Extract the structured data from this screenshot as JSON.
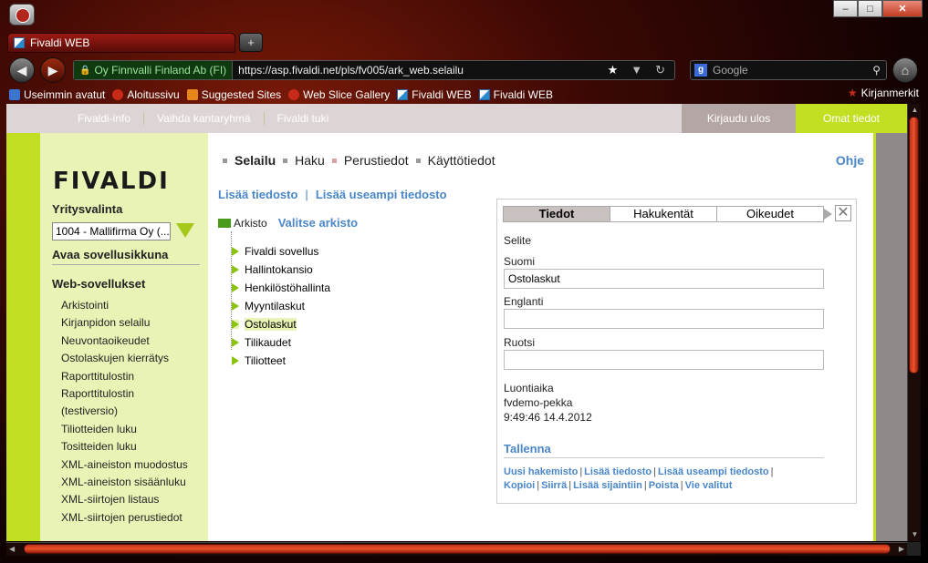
{
  "browser": {
    "tab_title": "Fivaldi WEB",
    "site_identity": "Oy Finnvalli Finland Ab (FI)",
    "url": "https://asp.fivaldi.net/pls/fv005/ark_web.selailu",
    "search_placeholder": "Google",
    "bookmarks": [
      "Useimmin avatut",
      "Aloitussivu",
      "Suggested Sites",
      "Web Slice Gallery",
      "Fivaldi WEB",
      "Fivaldi WEB"
    ],
    "bookmarks_menu": "Kirjanmerkit"
  },
  "topnav": {
    "links": [
      "Fivaldi-info",
      "Vaihda kantaryhmä",
      "Fivaldi tuki"
    ],
    "logout": "Kirjaudu ulos",
    "my_info": "Omat tiedot"
  },
  "sidebar": {
    "logo": "FIVALDI",
    "company_label": "Yritysvalinta",
    "company_value": "1004 - Mallifirma Oy (...",
    "open_window": "Avaa sovellusikkuna",
    "web_apps_label": "Web-sovellukset",
    "items": [
      "Arkistointi",
      "Kirjanpidon selailu",
      "Neuvontaoikeudet",
      "Ostolaskujen kierrätys",
      "Raporttitulostin",
      "Raporttitulostin",
      "(testiversio)",
      "Tiliotteiden luku",
      "Tositteiden luku",
      "XML-aineiston muodostus",
      "XML-aineiston sisäänluku",
      "XML-siirtojen listaus",
      "XML-siirtojen perustiedot"
    ]
  },
  "main": {
    "subnav": [
      "Selailu",
      "Haku",
      "Perustiedot",
      "Käyttötiedot"
    ],
    "help": "Ohje",
    "add_file": "Lisää tiedosto",
    "add_many": "Lisää useampi tiedosto",
    "separator": "|",
    "tree_root": "Arkisto",
    "choose_archive": "Valitse arkisto",
    "tree_items": [
      "Fivaldi sovellus",
      "Hallintokansio",
      "Henkilöstöhallinta",
      "Myyntilaskut",
      "Ostolaskut",
      "Tilikaudet",
      "Tiliotteet"
    ],
    "selected_item": "Ostolaskut"
  },
  "detail": {
    "tabs": [
      "Tiedot",
      "Hakukentät",
      "Oikeudet"
    ],
    "active_tab": "Tiedot",
    "selite_label": "Selite",
    "suomi_label": "Suomi",
    "suomi_value": "Ostolaskut",
    "englanti_label": "Englanti",
    "englanti_value": "",
    "ruotsi_label": "Ruotsi",
    "ruotsi_value": "",
    "created_label": "Luontiaika",
    "created_by": "fvdemo-pekka",
    "created_at": "9:49:46 14.4.2012",
    "save": "Tallenna",
    "actions_row1": [
      "Uusi hakemisto",
      "Lisää tiedosto",
      "Lisää useampi tiedosto"
    ],
    "actions_row2": [
      "Kopioi",
      "Siirrä",
      "Lisää sijaintiin",
      "Poista",
      "Vie valitut"
    ]
  }
}
